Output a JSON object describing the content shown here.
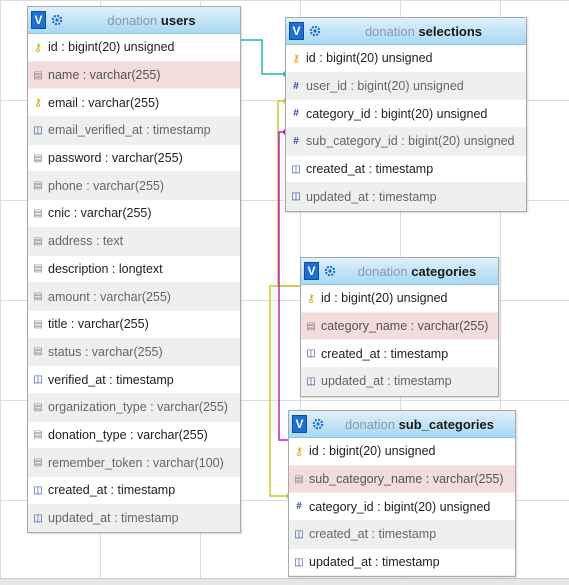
{
  "tables": {
    "users": {
      "db": "donation",
      "name": "users",
      "columns": [
        {
          "label": "id : bigint(20) unsigned",
          "icon": "key-icon",
          "style": ""
        },
        {
          "label": "name : varchar(255)",
          "icon": "text-column-icon",
          "style": "hl"
        },
        {
          "label": "email : varchar(255)",
          "icon": "key-icon",
          "style": ""
        },
        {
          "label": "email_verified_at : timestamp",
          "icon": "date-column-icon",
          "style": "alt"
        },
        {
          "label": "password : varchar(255)",
          "icon": "text-column-icon",
          "style": ""
        },
        {
          "label": "phone : varchar(255)",
          "icon": "text-column-icon",
          "style": "alt"
        },
        {
          "label": "cnic : varchar(255)",
          "icon": "text-column-icon",
          "style": ""
        },
        {
          "label": "address : text",
          "icon": "text-column-icon",
          "style": "alt"
        },
        {
          "label": "description : longtext",
          "icon": "text-column-icon",
          "style": ""
        },
        {
          "label": "amount : varchar(255)",
          "icon": "text-column-icon",
          "style": "alt"
        },
        {
          "label": "title : varchar(255)",
          "icon": "text-column-icon",
          "style": ""
        },
        {
          "label": "status : varchar(255)",
          "icon": "text-column-icon",
          "style": "alt"
        },
        {
          "label": "verified_at : timestamp",
          "icon": "date-column-icon",
          "style": ""
        },
        {
          "label": "organization_type : varchar(255)",
          "icon": "text-column-icon",
          "style": "alt"
        },
        {
          "label": "donation_type : varchar(255)",
          "icon": "text-column-icon",
          "style": ""
        },
        {
          "label": "remember_token : varchar(100)",
          "icon": "text-column-icon",
          "style": "alt"
        },
        {
          "label": "created_at : timestamp",
          "icon": "date-column-icon",
          "style": ""
        },
        {
          "label": "updated_at : timestamp",
          "icon": "date-column-icon",
          "style": "alt"
        }
      ]
    },
    "selections": {
      "db": "donation",
      "name": "selections",
      "columns": [
        {
          "label": "id : bigint(20) unsigned",
          "icon": "key-icon",
          "style": ""
        },
        {
          "label": "user_id : bigint(20) unsigned",
          "icon": "number-column-icon",
          "style": "alt"
        },
        {
          "label": "category_id : bigint(20) unsigned",
          "icon": "number-column-icon",
          "style": ""
        },
        {
          "label": "sub_category_id : bigint(20) unsigned",
          "icon": "number-column-icon",
          "style": "alt"
        },
        {
          "label": "created_at : timestamp",
          "icon": "date-column-icon",
          "style": ""
        },
        {
          "label": "updated_at : timestamp",
          "icon": "date-column-icon",
          "style": "alt"
        }
      ]
    },
    "categories": {
      "db": "donation",
      "name": "categories",
      "columns": [
        {
          "label": "id : bigint(20) unsigned",
          "icon": "key-icon",
          "style": ""
        },
        {
          "label": "category_name : varchar(255)",
          "icon": "text-column-icon",
          "style": "hl"
        },
        {
          "label": "created_at : timestamp",
          "icon": "date-column-icon",
          "style": ""
        },
        {
          "label": "updated_at : timestamp",
          "icon": "date-column-icon",
          "style": "alt"
        }
      ]
    },
    "sub_categories": {
      "db": "donation",
      "name": "sub_categories",
      "columns": [
        {
          "label": "id : bigint(20) unsigned",
          "icon": "key-icon",
          "style": ""
        },
        {
          "label": "sub_category_name : varchar(255)",
          "icon": "text-column-icon",
          "style": "hl"
        },
        {
          "label": "category_id : bigint(20) unsigned",
          "icon": "number-column-icon",
          "style": ""
        },
        {
          "label": "created_at : timestamp",
          "icon": "date-column-icon",
          "style": "alt"
        },
        {
          "label": "updated_at : timestamp",
          "icon": "date-column-icon",
          "style": ""
        }
      ]
    }
  },
  "toggle_label": "V",
  "colors": {
    "header_top": "#dff0fb",
    "header_bottom": "#a9d8f3",
    "link_users": "#1fb7b7",
    "link_categories": "#c8c832",
    "link_sub_categories": "#c020c0"
  }
}
